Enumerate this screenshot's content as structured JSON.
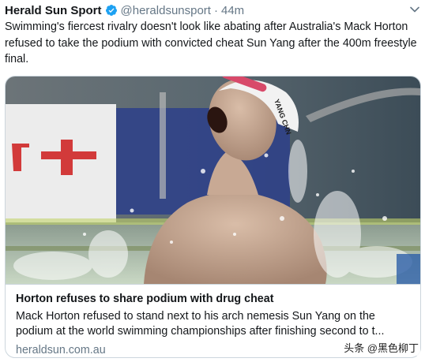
{
  "tweet": {
    "display_name": "Herald Sun Sport",
    "handle": "@heraldsunsport",
    "separator": "·",
    "timestamp": "44m",
    "text": "Swimming's fiercest rivalry doesn't look like abating after Australia's Mack Horton refused to take the podium with convicted cheat Sun Yang after the 400m freestyle final."
  },
  "card": {
    "title": "Horton refuses to share podium with drug cheat",
    "description": "Mack Horton refused to stand next to his arch nemesis Sun Yang on the podium at the world swimming championships after finishing second to t...",
    "domain": "heraldsun.com.au",
    "image_cap_text": "YANG CHN"
  },
  "watermark": "头条 @黑色柳丁",
  "colors": {
    "verified_blue": "#1da1f2",
    "secondary_text": "#657786",
    "border": "#ccd6dd"
  },
  "icons": [
    "verified-badge-icon",
    "chevron-down-icon"
  ]
}
